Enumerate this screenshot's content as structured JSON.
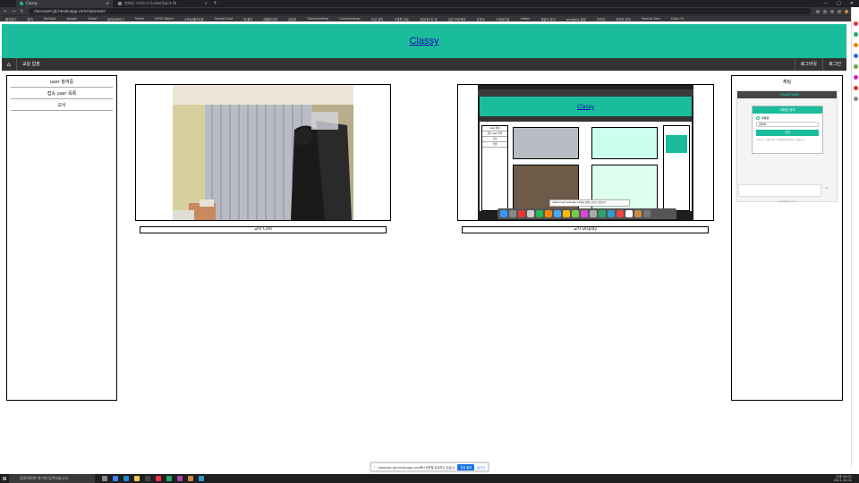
{
  "browser": {
    "tabs": [
      {
        "label": "Classy",
        "active": true
      },
      {
        "label": "현재창 가져오기 Guide(Quick Bl",
        "active": false
      }
    ],
    "address": "classroom-jjk.herokuapp.com/classroom",
    "bookmarks": [
      "즐겨찾기",
      "원격",
      "YouTube",
      "google",
      "Gmail",
      "회의녹화하기",
      "Twitch",
      "NYSE Watch",
      "소프트웨어지원",
      "SoundCloud",
      "새 폴더",
      "레벨하이커",
      "섭타운",
      "Stackoverflow",
      "Commonshop",
      "코딩 강의",
      "그래픽 자료",
      "코딩테스트 정",
      "실전 프로젝트",
      "유튜브",
      "스위핑기업",
      "notion",
      "개발자 문서",
      "windows 설정",
      "연락처",
      "연락처 정리",
      "Product Fam",
      "Claim Fo"
    ]
  },
  "site": {
    "title": "Classy",
    "nav": {
      "home_icon": "home-icon",
      "classroom_label": "교실 입장",
      "logout_label": "로그아웃",
      "login_label": "로그인"
    }
  },
  "left_panel": {
    "items": [
      "user 참여중",
      "접속 user 목록",
      "교사"
    ]
  },
  "main": {
    "cam_caption": "교사 Cam",
    "display_caption": "교사 Display",
    "display_inner": {
      "title": "Classy",
      "left_items": [
        "user 참여",
        "접속 user 목록",
        "교사",
        "학생"
      ],
      "share_text": "classroom-jjk.herokuapp.com에서 화면을 공유하고 있습니다."
    }
  },
  "chat": {
    "title": "채팅",
    "brand": "TOGETHER",
    "login_label": "대화방 참여",
    "option_label": "대화명",
    "field_value": "관리자",
    "button_label": "입장",
    "notice": "사용자는 닉네임 입력 후 대화방에 참여할 수 있습니다.",
    "footer": "together.com"
  },
  "share_bar": {
    "text": "classroom-jjk.herokuapp.com에서 화면을 공유하고 있습니다.",
    "stop_label": "공유 중지",
    "hide_label": "숨기기"
  },
  "taskbar": {
    "search_placeholder": "검색하려면 여기에 입력하십시오.",
    "time": "오후 10:01",
    "date": "2021-12-01"
  },
  "colors": {
    "header": "#1abc9c",
    "nav": "#333333",
    "link": "#1a0dab"
  }
}
